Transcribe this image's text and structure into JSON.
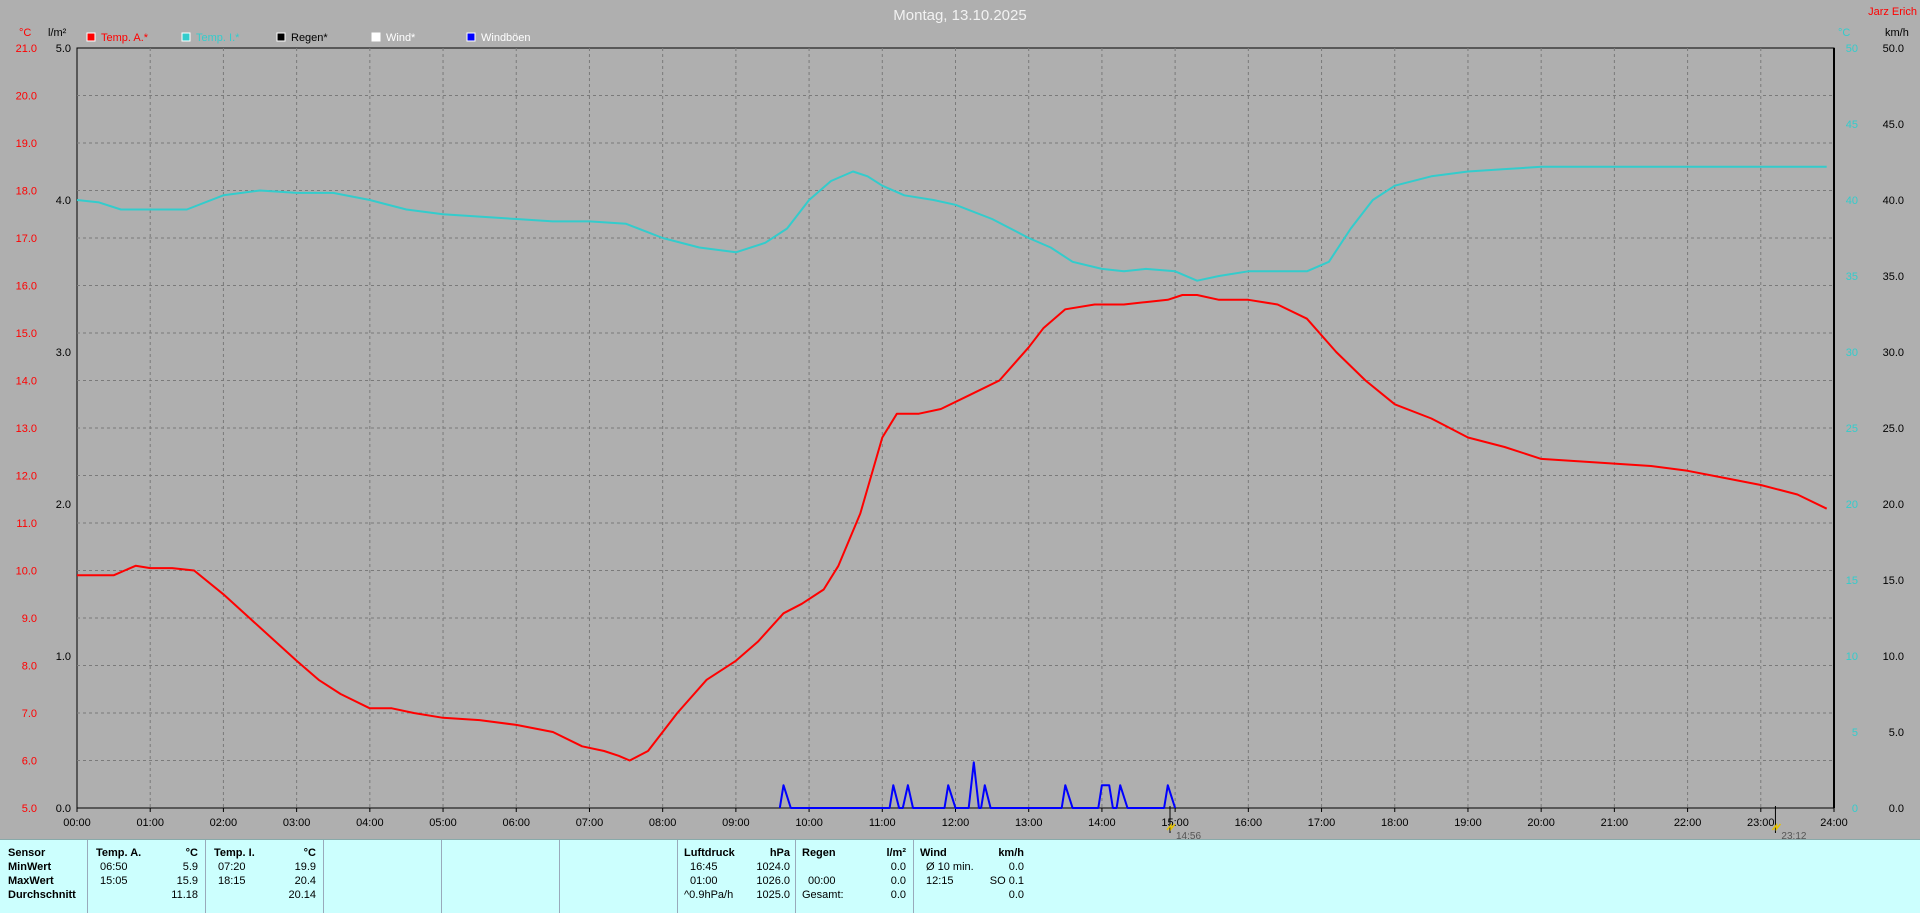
{
  "header": {
    "title": "Montag, 13.10.2025",
    "station": "Jarz Erich"
  },
  "legend": [
    {
      "label": "Temp. A.*",
      "color": "#ff0000"
    },
    {
      "label": "Temp. I.*",
      "color": "#33cccc"
    },
    {
      "label": "Regen*",
      "color": "#000000"
    },
    {
      "label": "Wind*",
      "color": "#ffffff"
    },
    {
      "label": "Windböen",
      "color": "#0000ff"
    }
  ],
  "chart_data": {
    "type": "line",
    "title": "Montag, 13.10.2025",
    "grid": true,
    "legend_position": "top-left",
    "x_ticks": [
      "00:00",
      "01:00",
      "02:00",
      "03:00",
      "04:00",
      "05:00",
      "06:00",
      "07:00",
      "08:00",
      "09:00",
      "10:00",
      "11:00",
      "12:00",
      "13:00",
      "14:00",
      "15:00",
      "16:00",
      "17:00",
      "18:00",
      "19:00",
      "20:00",
      "21:00",
      "22:00",
      "23:00",
      "24:00"
    ],
    "axes": {
      "temp": {
        "unit": "°C",
        "range": [
          5,
          21
        ],
        "ticks": [
          "5.0",
          "6.0",
          "7.0",
          "8.0",
          "9.0",
          "10.0",
          "11.0",
          "12.0",
          "13.0",
          "14.0",
          "15.0",
          "16.0",
          "17.0",
          "18.0",
          "19.0",
          "20.0",
          "21.0"
        ],
        "color": "#ff0000"
      },
      "rain": {
        "unit": "l/m²",
        "range": [
          0,
          5
        ],
        "ticks": [
          "0.0",
          "1.0",
          "2.0",
          "3.0",
          "4.0",
          "5.0"
        ],
        "color": "#000000"
      },
      "inner": {
        "unit": "°C",
        "color": "#33cccc",
        "ticks": [
          "0",
          "5",
          "10",
          "15",
          "20",
          "25",
          "30",
          "35",
          "40",
          "45",
          "50"
        ]
      },
      "wind": {
        "unit": "km/h",
        "range": [
          0,
          50
        ],
        "ticks": [
          "0.0",
          "5.0",
          "10.0",
          "15.0",
          "20.0",
          "25.0",
          "30.0",
          "35.0",
          "40.0",
          "45.0",
          "50.0"
        ]
      }
    },
    "series": [
      {
        "name": "Temp. A.*",
        "axis": "temp",
        "color": "#ff0000",
        "x": [
          0,
          0.5,
          0.8,
          1.0,
          1.3,
          1.6,
          2.0,
          2.5,
          3.0,
          3.3,
          3.6,
          4.0,
          4.3,
          4.6,
          5.0,
          5.5,
          6.0,
          6.5,
          6.9,
          7.2,
          7.4,
          7.55,
          7.8,
          8.2,
          8.6,
          9.0,
          9.3,
          9.65,
          9.9,
          10.2,
          10.4,
          10.7,
          10.85,
          11.0,
          11.2,
          11.5,
          11.8,
          12.2,
          12.6,
          13.0,
          13.2,
          13.5,
          13.9,
          14.3,
          14.6,
          14.9,
          15.1,
          15.3,
          15.6,
          16.0,
          16.4,
          16.8,
          17.2,
          17.6,
          18.0,
          18.5,
          19.0,
          19.5,
          20.0,
          20.5,
          21.0,
          21.5,
          22.0,
          22.5,
          23.0,
          23.5,
          23.9
        ],
        "values": [
          9.9,
          9.9,
          10.1,
          10.05,
          10.05,
          10.0,
          9.5,
          8.8,
          8.1,
          7.7,
          7.4,
          7.1,
          7.1,
          7.0,
          6.9,
          6.85,
          6.75,
          6.6,
          6.3,
          6.2,
          6.1,
          6.0,
          6.2,
          7.0,
          7.7,
          8.1,
          8.5,
          9.1,
          9.3,
          9.6,
          10.1,
          11.2,
          12.0,
          12.8,
          13.3,
          13.3,
          13.4,
          13.7,
          14.0,
          14.7,
          15.1,
          15.5,
          15.6,
          15.6,
          15.65,
          15.7,
          15.8,
          15.8,
          15.7,
          15.7,
          15.6,
          15.3,
          14.6,
          14.0,
          13.5,
          13.2,
          12.8,
          12.6,
          12.35,
          12.3,
          12.25,
          12.2,
          12.1,
          11.95,
          11.8,
          11.6,
          11.3
        ]
      },
      {
        "name": "Temp. I.*",
        "axis": "temp",
        "color": "#33cccc",
        "x": [
          0,
          0.3,
          0.6,
          1.0,
          1.5,
          2.0,
          2.5,
          3.0,
          3.5,
          4.0,
          4.5,
          5.0,
          5.5,
          6.0,
          6.5,
          7.0,
          7.5,
          8.0,
          8.5,
          9.0,
          9.4,
          9.7,
          10.0,
          10.3,
          10.6,
          10.8,
          11.0,
          11.3,
          11.7,
          12.0,
          12.5,
          13.0,
          13.3,
          13.6,
          14.0,
          14.3,
          14.6,
          15.0,
          15.3,
          15.6,
          16.0,
          16.4,
          16.8,
          17.1,
          17.4,
          17.7,
          18.0,
          18.5,
          19.0,
          19.5,
          20.0,
          20.5,
          21.0,
          21.5,
          22.0,
          22.5,
          23.0,
          23.5,
          23.9
        ],
        "values": [
          17.8,
          17.75,
          17.6,
          17.6,
          17.6,
          17.9,
          18.0,
          17.95,
          17.95,
          17.8,
          17.6,
          17.5,
          17.45,
          17.4,
          17.35,
          17.35,
          17.3,
          17.0,
          16.8,
          16.7,
          16.9,
          17.2,
          17.8,
          18.2,
          18.4,
          18.3,
          18.1,
          17.9,
          17.8,
          17.7,
          17.4,
          17.0,
          16.8,
          16.5,
          16.35,
          16.3,
          16.35,
          16.3,
          16.1,
          16.2,
          16.3,
          16.3,
          16.3,
          16.5,
          17.2,
          17.8,
          18.1,
          18.3,
          18.4,
          18.45,
          18.5,
          18.5,
          18.5,
          18.5,
          18.5,
          18.5,
          18.5,
          18.5,
          18.5
        ]
      },
      {
        "name": "Windböen",
        "axis": "wind",
        "color": "#0000ff",
        "x": [
          9.6,
          9.65,
          9.75,
          11.1,
          11.15,
          11.23,
          11.28,
          11.35,
          11.42,
          11.85,
          11.9,
          12.0,
          12.18,
          12.25,
          12.32,
          12.35,
          12.4,
          12.48,
          13.45,
          13.5,
          13.6,
          13.95,
          14.0,
          14.1,
          14.15,
          14.2,
          14.25,
          14.35,
          14.42,
          14.85,
          14.9,
          15.0
        ],
        "values": [
          0,
          1.5,
          0,
          0,
          1.5,
          0,
          0,
          1.5,
          0,
          0,
          1.5,
          0,
          0,
          3.0,
          0,
          0,
          1.5,
          0,
          0,
          1.5,
          0,
          0,
          1.5,
          1.5,
          0,
          0,
          1.5,
          0,
          0,
          0,
          1.5,
          0
        ]
      }
    ],
    "markers": [
      {
        "x": 14.93,
        "label": "14:56"
      },
      {
        "x": 23.2,
        "label": "23:12"
      }
    ]
  },
  "stats": {
    "row_labels": [
      "Sensor",
      "MinWert",
      "MaxWert",
      "Durchschnitt"
    ],
    "temp_a": {
      "title": "Temp. A.",
      "unit": "°C",
      "min_time": "06:50",
      "min": "5.9",
      "max_time": "15:05",
      "max": "15.9",
      "avg": "11.18"
    },
    "temp_i": {
      "title": "Temp. I.",
      "unit": "°C",
      "min_time": "07:20",
      "min": "19.9",
      "max_time": "18:15",
      "max": "20.4",
      "avg": "20.14"
    },
    "pressure": {
      "title": "Luftdruck",
      "unit": "hPa",
      "min_time": "16:45",
      "min": "1024.0",
      "max_time": "01:00",
      "max": "1026.0",
      "trend": "^0.9hPa/h",
      "avg": "1025.0"
    },
    "rain": {
      "title": "Regen",
      "unit": "l/m²",
      "r1": "",
      "r1v": "0.0",
      "r2": "00:00",
      "r2v": "0.0",
      "r3": "Gesamt:",
      "r3v": "0.0"
    },
    "wind": {
      "title": "Wind",
      "unit": "km/h",
      "r1": "Ø 10 min.",
      "r1v": "0.0",
      "r2": "12:15",
      "r2v": "SO 0.1",
      "r3": "",
      "r3v": "0.0"
    }
  }
}
